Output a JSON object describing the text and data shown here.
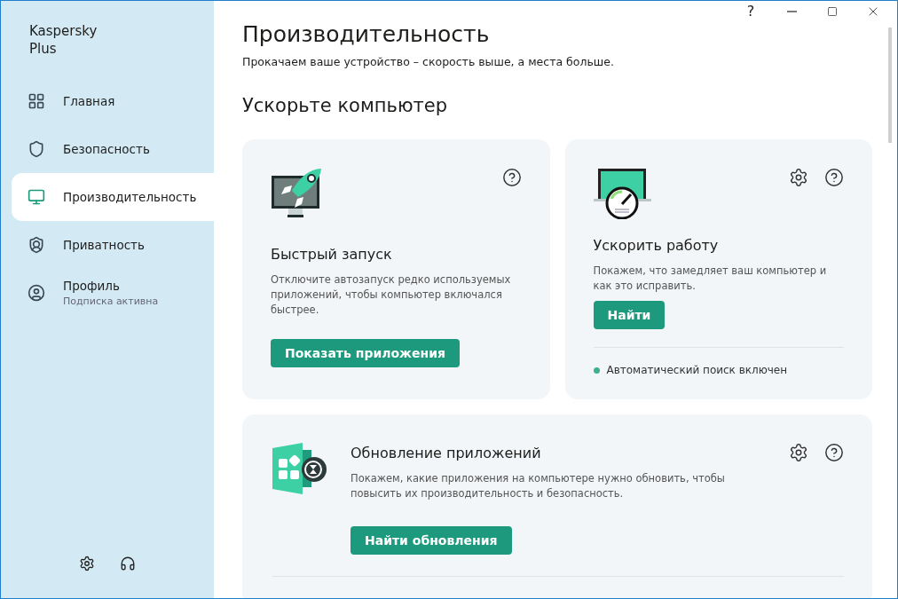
{
  "app": {
    "title": "Kaspersky Plus"
  },
  "sidebar": {
    "items": [
      {
        "kind": "home",
        "label": "Главная",
        "selected": false
      },
      {
        "kind": "security",
        "label": "Безопасность",
        "selected": false
      },
      {
        "kind": "performance",
        "label": "Производительность",
        "selected": true
      },
      {
        "kind": "privacy",
        "label": "Приватность",
        "selected": false
      },
      {
        "kind": "profile",
        "label": "Профиль",
        "subtitle": "Подписка активна",
        "selected": false
      }
    ]
  },
  "window_controls": {
    "help": "?"
  },
  "page": {
    "title": "Производительность",
    "subtitle": "Прокачаем ваше устройство – скорость выше, а места больше.",
    "section": "Ускорьте компьютер"
  },
  "cards": [
    {
      "kind": "startup",
      "title": "Быстрый запуск",
      "text": "Отключите автозапуск редко используемых приложений, чтобы компьютер включался быстрее.",
      "button": "Показать приложения",
      "settings": false
    },
    {
      "kind": "speedup",
      "title": "Ускорить работу",
      "text": "Покажем, что замедляет ваш компьютер и как это исправить.",
      "button": "Найти",
      "settings": true,
      "status": {
        "text": "Автоматический поиск включен",
        "color": "#3daf8c"
      }
    },
    {
      "kind": "updates",
      "title": "Обновление приложений",
      "text": "Покажем, какие приложения на компьютере нужно обновить, чтобы повысить их производительность и безопасность.",
      "button": "Найти обновления",
      "settings": true
    }
  ]
}
